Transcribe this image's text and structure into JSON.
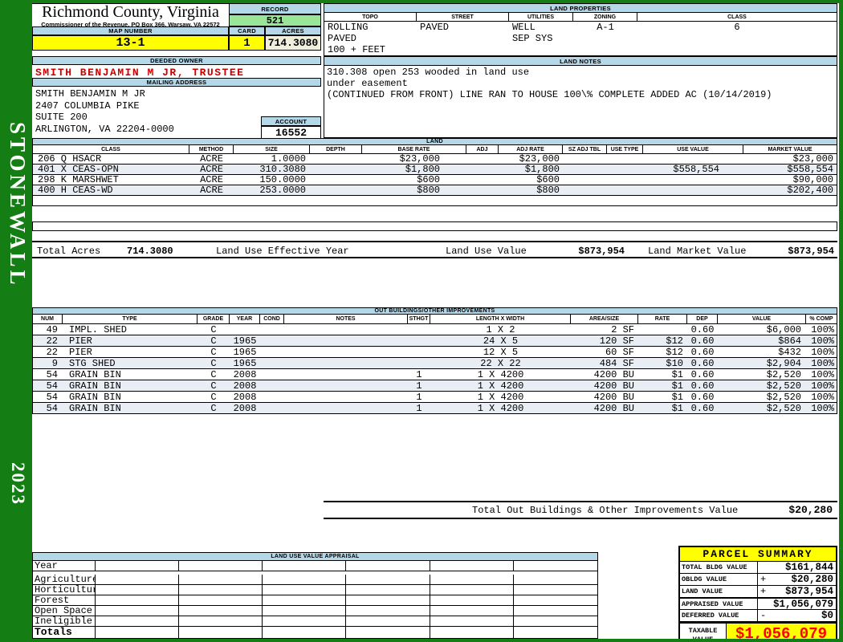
{
  "sidebar": {
    "district": "STONEWALL",
    "year": "2023"
  },
  "header": {
    "county": "Richmond County, Virginia",
    "commissioner": "Commissioner of the Revenue, PO Box 366, Warsaw, VA 22572",
    "record_label": "RECORD",
    "record_value": "521",
    "map_label": "MAP NUMBER",
    "map_value": "13-1",
    "card_label": "CARD",
    "card_value": "1",
    "acres_label": "ACRES",
    "acres_value": "714.3080"
  },
  "land_properties": {
    "title": "LAND PROPERTIES",
    "columns": [
      "TOPO",
      "STREET",
      "UTILITIES",
      "ZONING",
      "CLASS"
    ],
    "values": [
      [
        "ROLLING",
        "PAVED",
        "100 + FEET"
      ],
      [
        "PAVED"
      ],
      [
        "WELL",
        "SEP SYS"
      ],
      [
        "A-1"
      ],
      [
        "6"
      ]
    ]
  },
  "owner": {
    "deeded_label": "DEEDED OWNER",
    "name": "SMITH BENJAMIN M JR, TRUSTEE",
    "mailing_label": "MAILING ADDRESS",
    "address_lines": [
      "SMITH BENJAMIN M JR",
      "2407 COLUMBIA PIKE",
      "SUITE 200",
      "ARLINGTON, VA 22204-0000"
    ],
    "account_label": "ACCOUNT",
    "account_value": "16552"
  },
  "land_notes": {
    "title": "LAND NOTES",
    "lines": [
      "310.308 open 253 wooded in land use",
      "under easement",
      "(CONTINUED FROM FRONT) LINE RAN TO HOUSE 100\\% COMPLETE ADDED AC (10/14/2019)"
    ]
  },
  "land_table": {
    "title": "LAND",
    "columns": [
      "CLASS",
      "METHOD",
      "SIZE",
      "DEPTH",
      "BASE RATE",
      "ADJ",
      "ADJ RATE",
      "SZ ADJ TBL",
      "USE TYPE",
      "USE VALUE",
      "MARKET VALUE"
    ],
    "rows": [
      [
        "206 Q HSACR",
        "ACRE",
        "1.0000",
        "",
        "$23,000",
        "",
        "$23,000",
        "",
        "",
        "",
        "$23,000"
      ],
      [
        "401 X CEAS-OPN",
        "ACRE",
        "310.3080",
        "",
        "$1,800",
        "",
        "$1,800",
        "",
        "",
        "$558,554",
        "$558,554"
      ],
      [
        "298 K MARSHWET",
        "ACRE",
        "150.0000",
        "",
        "$600",
        "",
        "$600",
        "",
        "",
        "",
        "$90,000"
      ],
      [
        "400 H CEAS-WD",
        "ACRE",
        "253.0000",
        "",
        "$800",
        "",
        "$800",
        "",
        "",
        "",
        "$202,400"
      ]
    ],
    "totals": {
      "total_acres_label": "Total Acres",
      "total_acres": "714.3080",
      "effective_year_label": "Land Use Effective Year",
      "use_value_label": "Land Use Value",
      "use_value": "$873,954",
      "market_value_label": "Land Market Value",
      "market_value": "$873,954"
    }
  },
  "outbuildings": {
    "title": "OUT BUILDINGS/OTHER IMPROVEMENTS",
    "columns": [
      "NUM",
      "TYPE",
      "GRADE",
      "YEAR",
      "COND",
      "NOTES",
      "STHGT",
      "LENGTH X WIDTH",
      "AREA/SIZE",
      "RATE",
      "DEP",
      "VALUE",
      "% COMP"
    ],
    "rows": [
      [
        "49",
        "IMPL. SHED",
        "C",
        "",
        "",
        "",
        "",
        "1 X 2",
        "2 SF",
        "",
        "0.60",
        "$6,000",
        "100%"
      ],
      [
        "22",
        "PIER",
        "C",
        "1965",
        "",
        "",
        "",
        "24 X 5",
        "120 SF",
        "$12",
        "0.60",
        "$864",
        "100%"
      ],
      [
        "22",
        "PIER",
        "C",
        "1965",
        "",
        "",
        "",
        "12 X 5",
        "60 SF",
        "$12",
        "0.60",
        "$432",
        "100%"
      ],
      [
        "9",
        "STG SHED",
        "C",
        "1965",
        "",
        "",
        "",
        "22 X 22",
        "484 SF",
        "$10",
        "0.60",
        "$2,904",
        "100%"
      ],
      [
        "54",
        "GRAIN BIN",
        "C",
        "2008",
        "",
        "",
        "1",
        "1 X 4200",
        "4200 BU",
        "$1",
        "0.60",
        "$2,520",
        "100%"
      ],
      [
        "54",
        "GRAIN BIN",
        "C",
        "2008",
        "",
        "",
        "1",
        "1 X 4200",
        "4200 BU",
        "$1",
        "0.60",
        "$2,520",
        "100%"
      ],
      [
        "54",
        "GRAIN BIN",
        "C",
        "2008",
        "",
        "",
        "1",
        "1 X 4200",
        "4200 BU",
        "$1",
        "0.60",
        "$2,520",
        "100%"
      ],
      [
        "54",
        "GRAIN BIN",
        "C",
        "2008",
        "",
        "",
        "1",
        "1 X 4200",
        "4200 BU",
        "$1",
        "0.60",
        "$2,520",
        "100%"
      ]
    ],
    "total_label": "Total Out Buildings & Other Improvements Value",
    "total_value": "$20,280"
  },
  "appraisal": {
    "title": "LAND USE VALUE APPRAISAL",
    "row_labels": [
      "Year",
      "Agriculture",
      "Horticulture",
      "Forest",
      "Open Space",
      "Ineligible",
      "Totals"
    ]
  },
  "parcel_summary": {
    "title": "PARCEL SUMMARY",
    "rows": [
      {
        "label": "TOTAL BLDG VALUE",
        "op": "",
        "value": "$161,844"
      },
      {
        "label": "OBLDG VALUE",
        "op": "+",
        "value": "$20,280"
      },
      {
        "label": "LAND VALUE",
        "op": "+",
        "value": "$873,954"
      },
      {
        "label": "APPRAISED VALUE",
        "op": "",
        "value": "$1,056,079"
      },
      {
        "label": "DEFERRED VALUE",
        "op": "-",
        "value": "$0"
      }
    ],
    "taxable_label": "TAXABLE VALUE",
    "taxable_value": "$1,056,079"
  },
  "colors": {
    "frame_green": "#147e14",
    "header_blue": "#b5d8e8",
    "highlight_yellow": "#ffff00",
    "record_green": "#99e699",
    "acres_cream": "#f0efde",
    "row_stripe": "#e9eef5",
    "owner_red": "#cc0000",
    "taxable_red": "#ff0000"
  }
}
